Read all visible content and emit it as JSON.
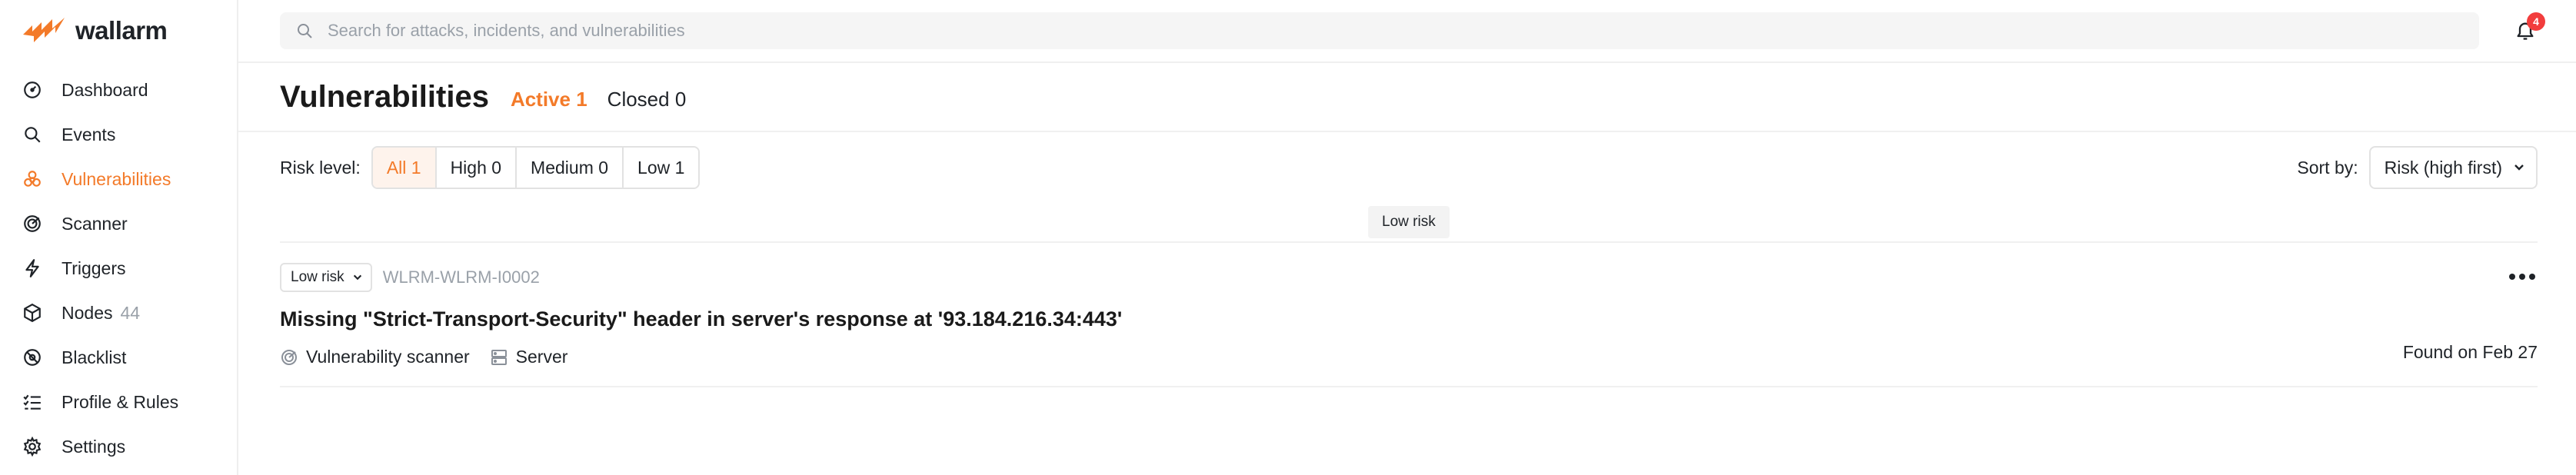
{
  "brand": {
    "name": "wallarm",
    "accent": "#f37a29"
  },
  "sidebar": {
    "items": [
      {
        "label": "Dashboard",
        "icon": "dashboard-icon"
      },
      {
        "label": "Events",
        "icon": "search-icon"
      },
      {
        "label": "Vulnerabilities",
        "icon": "biohazard-icon",
        "active": true
      },
      {
        "label": "Scanner",
        "icon": "scanner-icon"
      },
      {
        "label": "Triggers",
        "icon": "lightning-icon"
      },
      {
        "label": "Nodes",
        "icon": "nodes-icon",
        "count": "44"
      },
      {
        "label": "Blacklist",
        "icon": "blacklist-icon"
      },
      {
        "label": "Profile & Rules",
        "icon": "rules-icon"
      },
      {
        "label": "Settings",
        "icon": "gear-icon"
      }
    ]
  },
  "topbar": {
    "search_placeholder": "Search for attacks, incidents, and vulnerabilities",
    "notifications_count": "4"
  },
  "header": {
    "title": "Vulnerabilities",
    "tabs": [
      {
        "label": "Active 1",
        "active": true
      },
      {
        "label": "Closed 0",
        "active": false
      }
    ]
  },
  "filters": {
    "risk_label": "Risk level:",
    "options": [
      "All 1",
      "High 0",
      "Medium 0",
      "Low 1"
    ],
    "sort_label": "Sort by:",
    "sort_value": "Risk (high first)"
  },
  "group": {
    "label": "Low risk"
  },
  "vulnerability": {
    "risk": "Low risk",
    "id": "WLRM-WLRM-I0002",
    "title": "Missing \"Strict-Transport-Security\" header in server's response at '93.184.216.34:443'",
    "source": "Vulnerability scanner",
    "target": "Server",
    "found": "Found on Feb 27"
  }
}
